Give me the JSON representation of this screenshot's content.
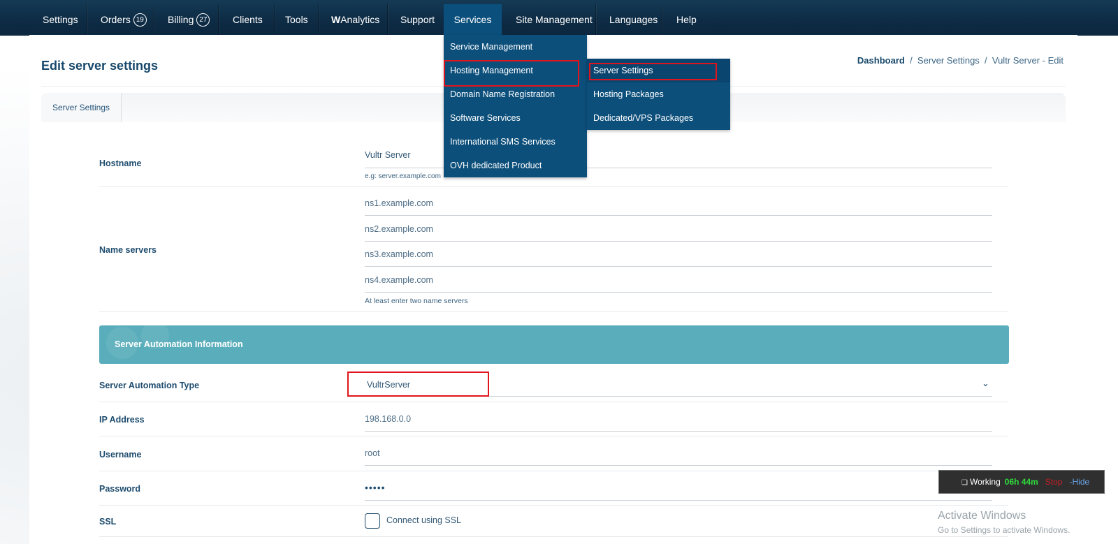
{
  "nav": {
    "items": [
      {
        "label": "Settings"
      },
      {
        "label": "Orders",
        "badge": "19"
      },
      {
        "label": "Billing",
        "badge": "27"
      },
      {
        "label": "Clients"
      },
      {
        "label": "Tools"
      },
      {
        "label_bold": "W",
        "label": "Analytics"
      },
      {
        "label": "Support"
      },
      {
        "label": "Services"
      },
      {
        "label": "Site Management"
      },
      {
        "label": "Languages"
      },
      {
        "label": "Help"
      }
    ]
  },
  "services_menu": {
    "items": [
      "Service Management",
      "Hosting Management",
      "Domain Name Registration",
      "Software Services",
      "International SMS Services",
      "OVH dedicated Product"
    ],
    "submenu": [
      "Server Settings",
      "Hosting Packages",
      "Dedicated/VPS Packages"
    ]
  },
  "page": {
    "title": "Edit server settings",
    "breadcrumb": {
      "home": "Dashboard",
      "sep": "/",
      "section": "Server Settings",
      "current": "Vultr Server - Edit"
    },
    "tab": "Server Settings"
  },
  "form": {
    "hostname": {
      "label": "Hostname",
      "value": "Vultr Server",
      "hint": "e.g: server.example.com"
    },
    "nameservers": {
      "label": "Name servers",
      "placeholders": [
        "ns1.example.com",
        "ns2.example.com",
        "ns3.example.com",
        "ns4.example.com"
      ],
      "hint": "At least enter two name servers"
    },
    "section_title": "Server Automation Information",
    "automation_type": {
      "label": "Server Automation Type",
      "value": "VultrServer"
    },
    "ip": {
      "label": "IP Address",
      "value": "198.168.0.0"
    },
    "username": {
      "label": "Username",
      "value": "root"
    },
    "password": {
      "label": "Password",
      "value": "•••••"
    },
    "ssl": {
      "label": "SSL",
      "checkbox_label": "Connect using SSL"
    }
  },
  "timer": {
    "status": "Working",
    "time": "06h 44m",
    "stop": "Stop",
    "hide": "-Hide"
  },
  "watermark": {
    "line1": "Activate Windows",
    "line2": "Go to Settings to activate Windows."
  },
  "colors": {
    "nav_bg": "#0e2c45",
    "menu_bg": "#0c4f7b",
    "section_bg": "#5aaebb",
    "highlight": "#e0141c",
    "timer_time": "#2fdb3c"
  }
}
